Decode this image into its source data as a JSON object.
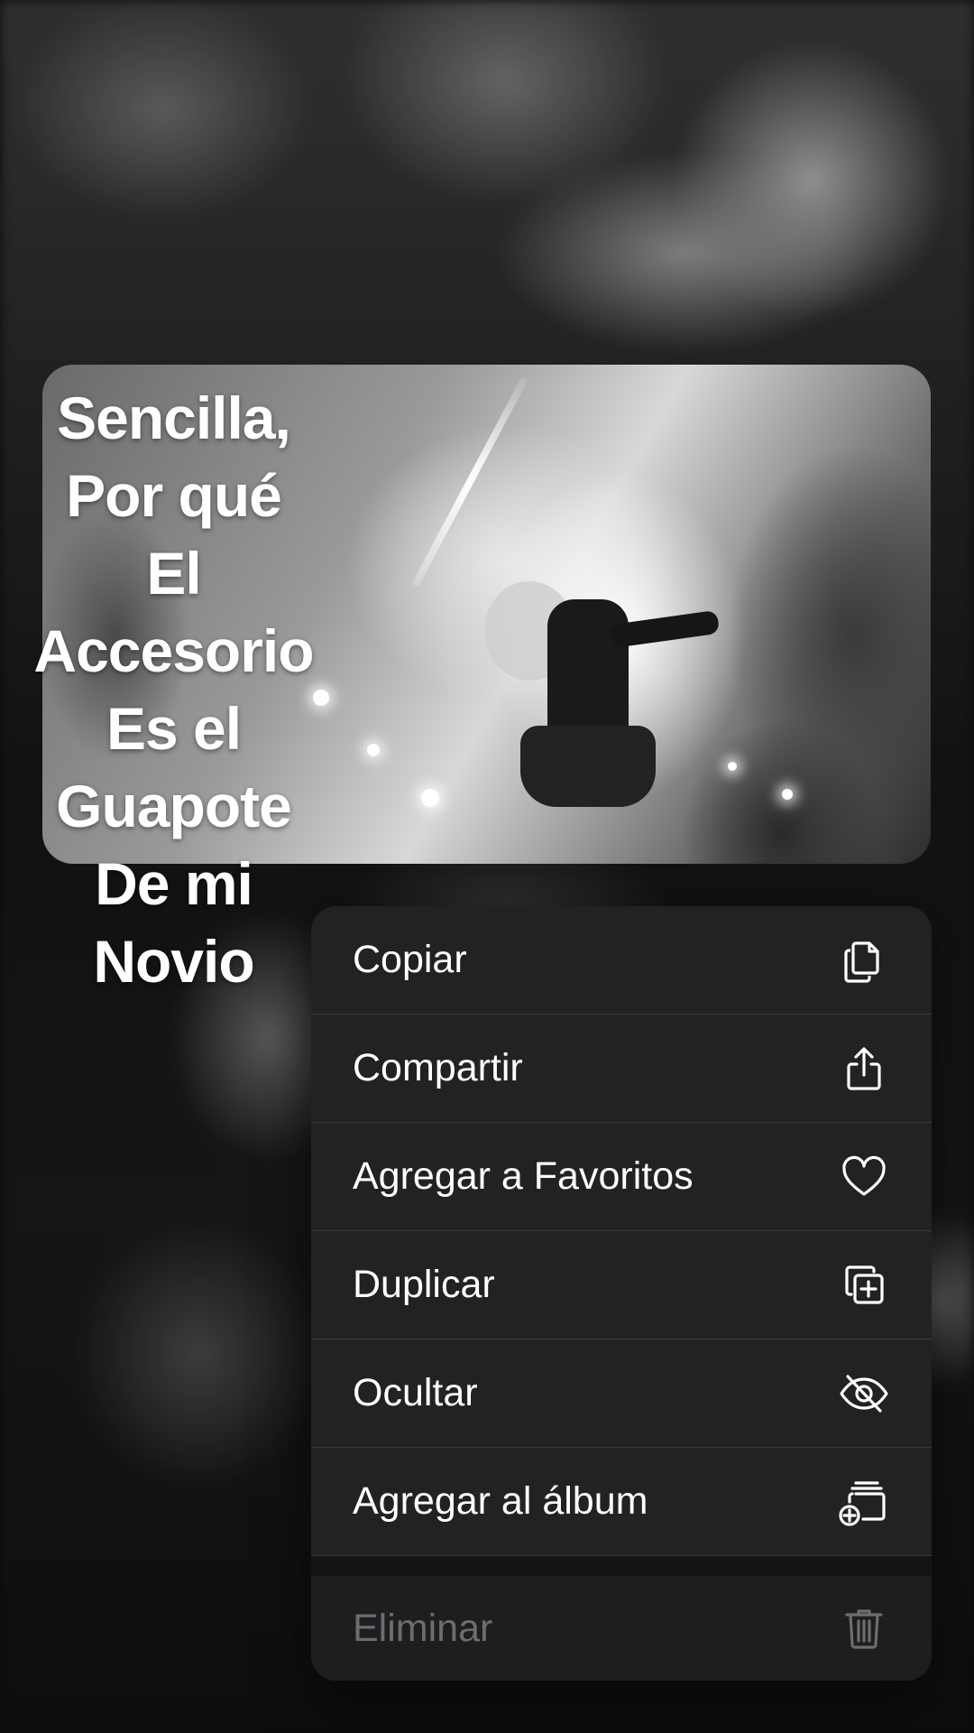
{
  "caption": {
    "lines": [
      "Sencilla,",
      "Por qué",
      "El",
      "Accesorio",
      "Es el",
      "Guapote",
      "De mi",
      "Novio"
    ]
  },
  "menu": {
    "items": [
      {
        "label": "Copiar",
        "icon": "copy-icon"
      },
      {
        "label": "Compartir",
        "icon": "share-icon"
      },
      {
        "label": "Agregar a Favoritos",
        "icon": "heart-icon"
      },
      {
        "label": "Duplicar",
        "icon": "duplicate-icon"
      },
      {
        "label": "Ocultar",
        "icon": "eye-slash-icon"
      },
      {
        "label": "Agregar al álbum",
        "icon": "add-to-album-icon"
      }
    ],
    "destructive": {
      "label": "Eliminar",
      "icon": "trash-icon",
      "disabled": true
    }
  },
  "colors": {
    "menu_text": "#ffffff",
    "disabled_text": "#6d6d70",
    "menu_background": "#222224"
  }
}
